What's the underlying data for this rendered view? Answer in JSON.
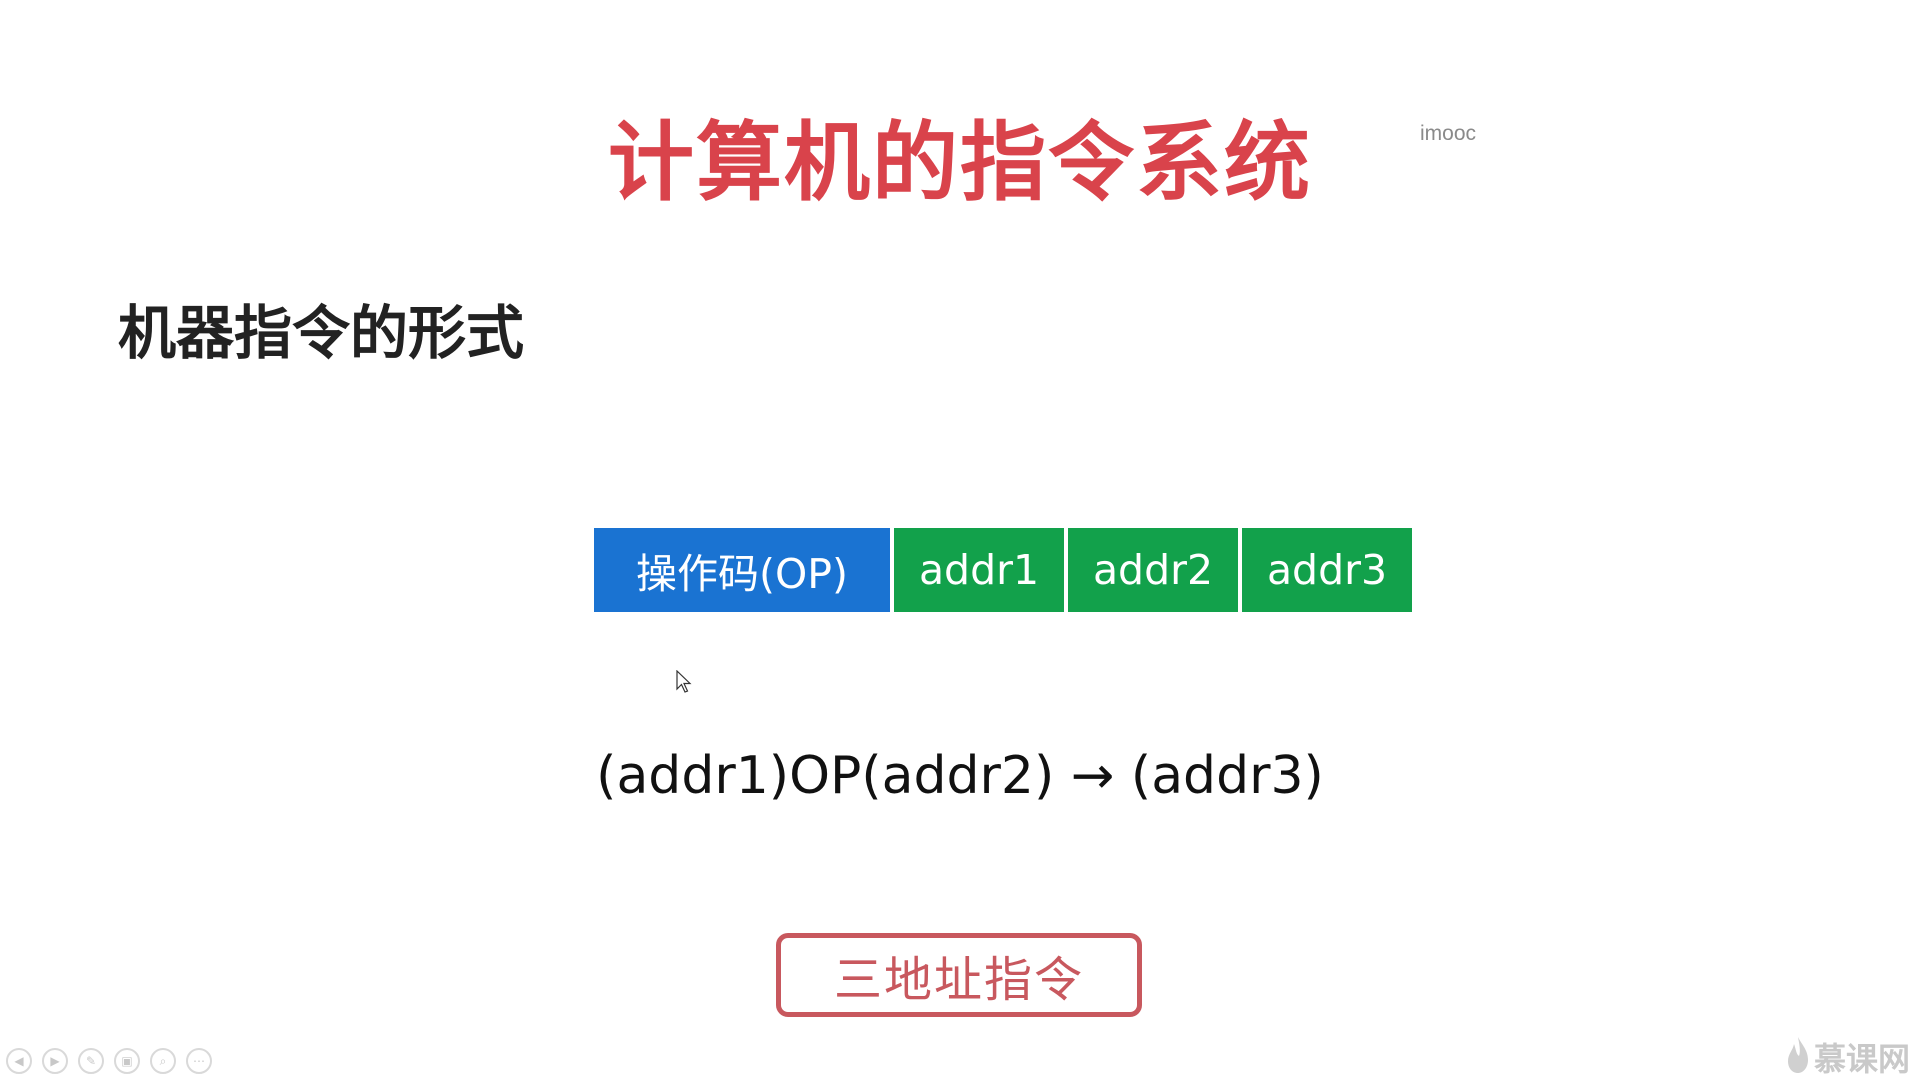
{
  "slide": {
    "title": "计算机的指令系统",
    "watermark": "imooc",
    "subtitle": "机器指令的形式",
    "formula": "(addr1)OP(addr2) → (addr3)",
    "badge": "三地址指令"
  },
  "instruction_fields": [
    {
      "label": "操作码(OP)",
      "color": "#1a73d2"
    },
    {
      "label": "addr1",
      "color": "#12a14b"
    },
    {
      "label": "addr2",
      "color": "#12a14b"
    },
    {
      "label": "addr3",
      "color": "#12a14b"
    }
  ],
  "colors": {
    "title": "#d9434b",
    "subtitle": "#222222",
    "badge_border": "#c8585e",
    "badge_text": "#c8585e"
  },
  "player_controls": [
    "prev-icon",
    "play-icon",
    "pen-icon",
    "copy-icon",
    "zoom-icon",
    "more-icon"
  ],
  "brand": {
    "name": "慕课网",
    "icon": "flame-icon"
  }
}
